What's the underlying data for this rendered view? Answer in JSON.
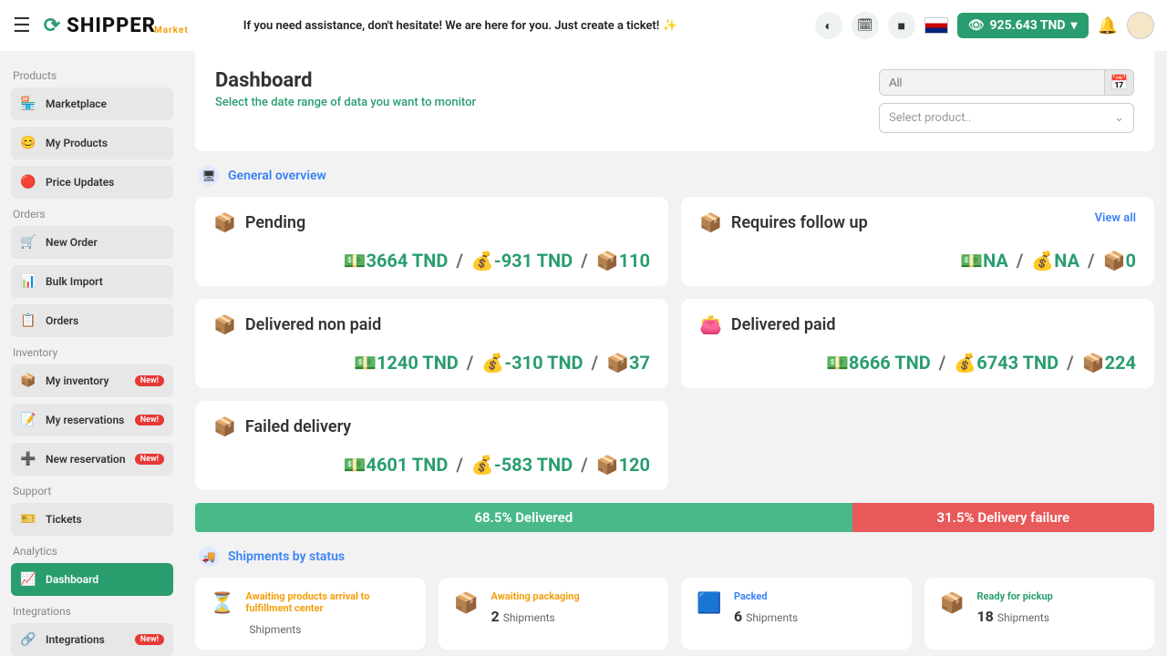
{
  "topbar": {
    "tagline": "If you need assistance, don't hesitate! We are here for you. Just create a ticket! ✨",
    "balance": "925.643 TND"
  },
  "sidebar": {
    "sections": {
      "products": "Products",
      "orders": "Orders",
      "inventory": "Inventory",
      "support": "Support",
      "analytics": "Analytics",
      "integrations": "Integrations"
    },
    "items": {
      "marketplace": "Marketplace",
      "myProducts": "My Products",
      "priceUpdates": "Price Updates",
      "newOrder": "New Order",
      "bulkImport": "Bulk Import",
      "orders": "Orders",
      "myInventory": "My inventory",
      "myReservations": "My reservations",
      "newReservation": "New reservation",
      "tickets": "Tickets",
      "dashboard": "Dashboard",
      "integrationsItem": "Integrations"
    },
    "newBadge": "New!"
  },
  "header": {
    "title": "Dashboard",
    "subtitle": "Select the date range of data you want to monitor",
    "datePlaceholder": "All",
    "productPlaceholder": "Select product.."
  },
  "overview": {
    "title": "General overview",
    "cards": {
      "pending": {
        "title": "Pending",
        "val1": "3664 TND",
        "val2": "-931 TND",
        "val3": "110"
      },
      "followup": {
        "title": "Requires follow up",
        "viewAll": "View all",
        "val1": "NA",
        "val2": "NA",
        "val3": "0"
      },
      "deliveredNonPaid": {
        "title": "Delivered non paid",
        "val1": "1240 TND",
        "val2": "-310 TND",
        "val3": "37"
      },
      "deliveredPaid": {
        "title": "Delivered paid",
        "val1": "8666 TND",
        "val2": "6743 TND",
        "val3": "224"
      },
      "failed": {
        "title": "Failed delivery",
        "val1": "4601 TND",
        "val2": "-583 TND",
        "val3": "120"
      }
    }
  },
  "progress": {
    "delivered": {
      "pct": 68.5,
      "label": "68.5% Delivered"
    },
    "failure": {
      "pct": 31.5,
      "label": "31.5% Delivery failure"
    }
  },
  "shipments": {
    "title": "Shipments by status",
    "suffix": "Shipments",
    "items": {
      "awaiting": {
        "title": "Awaiting products arrival to fulfillment center",
        "count": ""
      },
      "packaging": {
        "title": "Awaiting packaging",
        "count": "2"
      },
      "packed": {
        "title": "Packed",
        "count": "6"
      },
      "ready": {
        "title": "Ready for pickup",
        "count": "18"
      }
    }
  }
}
